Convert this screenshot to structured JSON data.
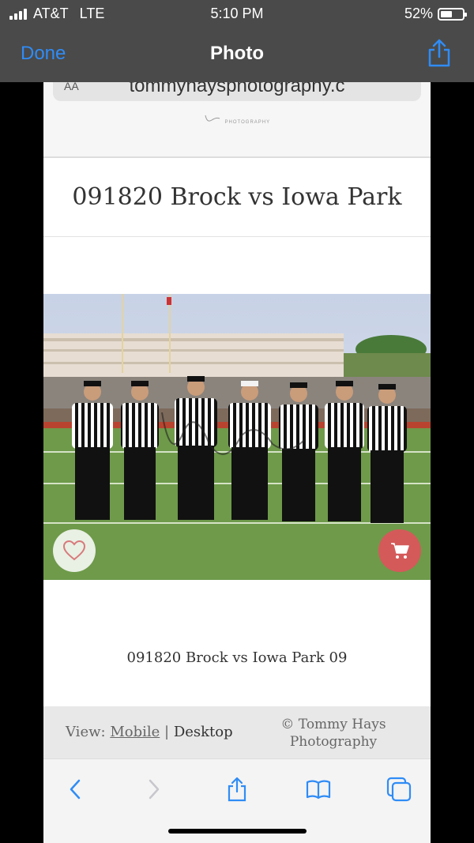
{
  "status_bar": {
    "carrier": "AT&T",
    "network": "LTE",
    "time": "5:10 PM",
    "battery": "52%",
    "battery_level": 0.52
  },
  "nav_bar": {
    "done_label": "Done",
    "title": "Photo",
    "share_icon": "share-icon"
  },
  "browser": {
    "url_text": "tommyhaysphotography.c",
    "reader_label": "AA"
  },
  "gallery": {
    "title": "091820 Brock vs Iowa Park",
    "photo_caption": "091820 Brock vs Iowa Park 09",
    "favorite_icon": "heart-icon",
    "cart_icon": "cart-icon",
    "cart_color": "#d45a5a",
    "logo_text": "PHOTOGRAPHY"
  },
  "footer": {
    "view_label": "View:",
    "mobile_link": "Mobile",
    "separator": "|",
    "desktop_label": "Desktop",
    "copyright": "© Tommy Hays Photography"
  },
  "toolbar": {
    "items": [
      "back-icon",
      "forward-icon",
      "share-icon",
      "bookmarks-icon",
      "tabs-icon"
    ],
    "accent": "#2f8cf6"
  }
}
